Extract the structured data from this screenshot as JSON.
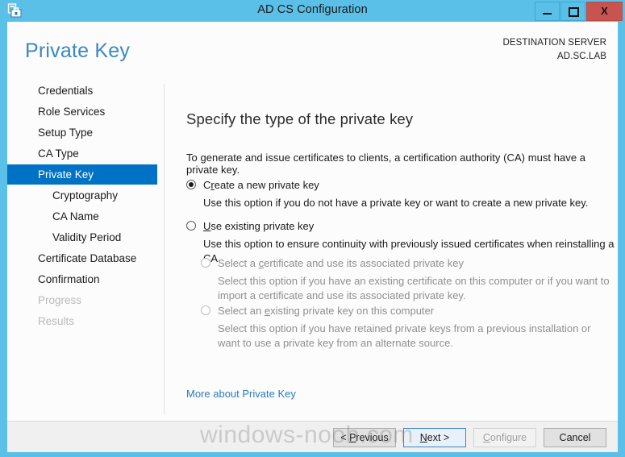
{
  "titlebar": {
    "icon": "server-config-icon",
    "title": "AD CS Configuration",
    "minimize_label": "Minimize",
    "maximize_label": "Maximize",
    "close_label": "X"
  },
  "header": {
    "page_title": "Private Key",
    "destination_label": "DESTINATION SERVER",
    "destination_value": "AD.SC.LAB"
  },
  "nav": {
    "items": [
      {
        "label": "Credentials",
        "level": 0,
        "state": "normal"
      },
      {
        "label": "Role Services",
        "level": 0,
        "state": "normal"
      },
      {
        "label": "Setup Type",
        "level": 0,
        "state": "normal"
      },
      {
        "label": "CA Type",
        "level": 0,
        "state": "normal"
      },
      {
        "label": "Private Key",
        "level": 0,
        "state": "selected"
      },
      {
        "label": "Cryptography",
        "level": 1,
        "state": "normal"
      },
      {
        "label": "CA Name",
        "level": 1,
        "state": "normal"
      },
      {
        "label": "Validity Period",
        "level": 1,
        "state": "normal"
      },
      {
        "label": "Certificate Database",
        "level": 0,
        "state": "normal"
      },
      {
        "label": "Confirmation",
        "level": 0,
        "state": "normal"
      },
      {
        "label": "Progress",
        "level": 0,
        "state": "disabled"
      },
      {
        "label": "Results",
        "level": 0,
        "state": "disabled"
      }
    ]
  },
  "content": {
    "heading": "Specify the type of the private key",
    "intro": "To generate and issue certificates to clients, a certification authority (CA) must have a private key.",
    "options": [
      {
        "label_pre": "C",
        "label_accel": "r",
        "label_post": "eate a new private key",
        "description": "Use this option if you do not have a private key or want to create a new private key.",
        "selected": true,
        "enabled": true
      },
      {
        "label_pre": "",
        "label_accel": "U",
        "label_post": "se existing private key",
        "description": "Use this option to ensure continuity with previously issued certificates when reinstalling a CA.",
        "selected": false,
        "enabled": true
      }
    ],
    "suboptions": [
      {
        "label_pre": "Select a ",
        "label_accel": "c",
        "label_post": "ertificate and use its associated private key",
        "description": "Select this option if you have an existing certificate on this computer or if you want to import a certificate and use its associated private key.",
        "selected": false,
        "enabled": false
      },
      {
        "label_pre": "Select an ",
        "label_accel": "e",
        "label_post": "xisting private key on this computer",
        "description": "Select this option if you have retained private keys from a previous installation or want to use a private key from an alternate source.",
        "selected": false,
        "enabled": false
      }
    ],
    "more_link": "More about Private Key"
  },
  "footer": {
    "buttons": [
      {
        "pre": "< ",
        "accel": "P",
        "post": "revious",
        "state": "normal"
      },
      {
        "pre": "",
        "accel": "N",
        "post": "ext >",
        "state": "default"
      },
      {
        "pre": "",
        "accel": "C",
        "post": "onfigure",
        "state": "disabled"
      },
      {
        "pre": "",
        "accel": "C",
        "post": "ancel",
        "state": "normal"
      }
    ]
  },
  "watermark": "windows-noob.com",
  "colors": {
    "window_frame": "#5BC0E8",
    "accent_blue": "#0072C6",
    "title_blue": "#3C87C3",
    "link_blue": "#2C7CBF",
    "close_red": "#C75450",
    "footer_gray": "#F0F0F0"
  }
}
